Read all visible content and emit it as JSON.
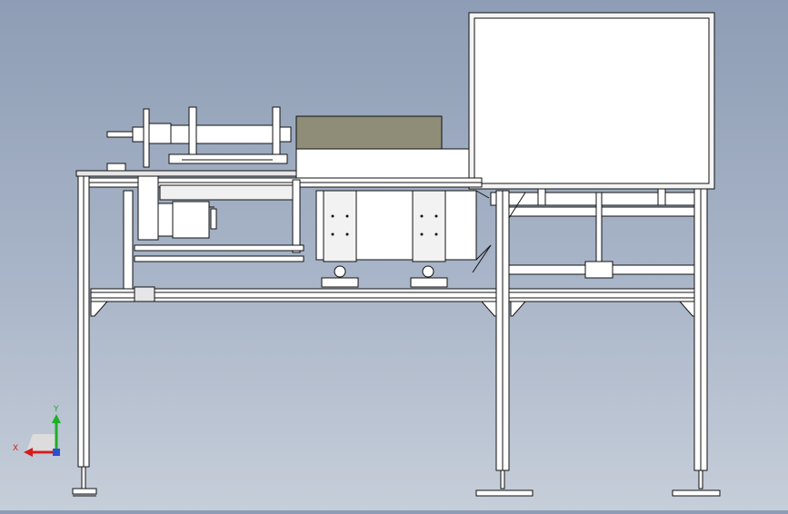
{
  "triad": {
    "x_label": "X",
    "y_label": "Y",
    "x_color": "#d21e1e",
    "y_color": "#1fae2a",
    "z_color": "#2a4fd2"
  },
  "colors": {
    "background_top": "#8e9db5",
    "background_bottom": "#c6ced9",
    "line": "#111111",
    "part_fill": "#ffffff",
    "box_lid": "#8f8d78",
    "shade": "#d9d9d9"
  }
}
